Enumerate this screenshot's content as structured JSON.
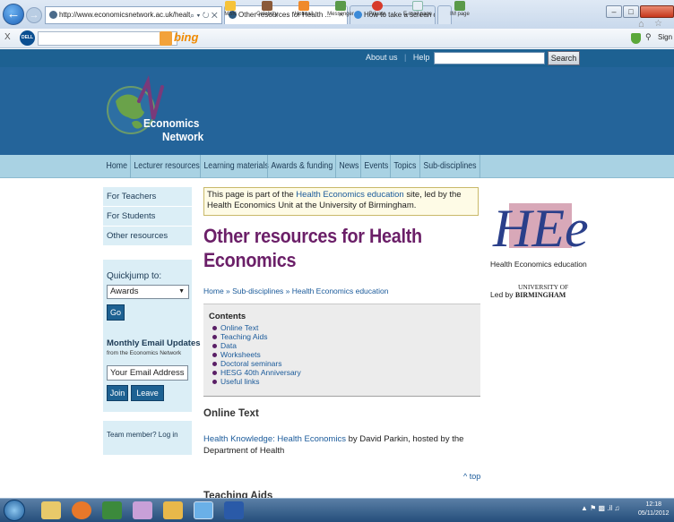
{
  "browser": {
    "address": "http://www.economicsnetwork.ac.uk/health/Other",
    "address_actions": "⌕ ▾ ↻ ✕",
    "tabs": [
      {
        "label": "Other resources for Health ...",
        "close": "✕"
      },
      {
        "label": "How to take a screen capture ..."
      }
    ],
    "window_controls": [
      "–",
      "□"
    ],
    "toolbar_close": "X",
    "toolbar_brand": "DELL",
    "bing_label": "bing",
    "toolbar_items": [
      "MSN",
      "Celebrity",
      "Hotmail",
      "Messenger",
      "Private",
      "E-mail page",
      "IM page"
    ],
    "signin_label": "Sign"
  },
  "site": {
    "top_links": {
      "about": "About us",
      "help": "Help"
    },
    "search_button": "Search",
    "logo_line1": "Economics",
    "logo_line2": "Network",
    "nav": [
      "Home",
      "Lecturer resources",
      "Learning materials",
      "Awards & funding",
      "News",
      "Events",
      "Topics",
      "Sub-disciplines"
    ]
  },
  "sidebar": {
    "items": [
      "For Teachers",
      "For Students",
      "Other resources"
    ],
    "quickjump_label": "Quickjump to:",
    "quickjump_value": "Awards",
    "go_label": "Go",
    "email_title": "Monthly Email Updates",
    "email_sub": "from the Economics Network",
    "email_value": "Your Email Address",
    "join_label": "Join",
    "leave_label": "Leave",
    "team_login": "Team member? Log in"
  },
  "main": {
    "notice_pre": "This page is part of the ",
    "notice_link": "Health Economics education",
    "notice_post": " site, led by the Health Economics Unit at the University of Birmingham.",
    "title": "Other resources for Health Economics",
    "breadcrumb": "Home » Sub-disciplines » Health Economics education",
    "contents_heading": "Contents",
    "contents_items": [
      "Online Text",
      "Teaching Aids",
      "Data",
      "Worksheets",
      "Doctoral seminars",
      "HESG 40th Anniversary",
      "Useful links"
    ],
    "section1_heading": "Online Text",
    "section1_link": "Health Knowledge: Health Economics",
    "section1_text": " by David Parkin, hosted by the Department of Health",
    "top_link": "^ top",
    "section2_heading": "Teaching Aids"
  },
  "right": {
    "hee_logo": "HEe",
    "caption": "Health Economics education",
    "university": "UNIVERSITY OF",
    "led_by": "Led by ",
    "birmingham": "BIRMINGHAM"
  },
  "taskbar": {
    "time": "12:18",
    "date": "05/11/2012"
  },
  "colors": {
    "header_blue": "#24649a",
    "nav_light_blue": "#a9d2e3",
    "title_purple": "#6b1f68",
    "link_blue": "#1a5a9a"
  }
}
